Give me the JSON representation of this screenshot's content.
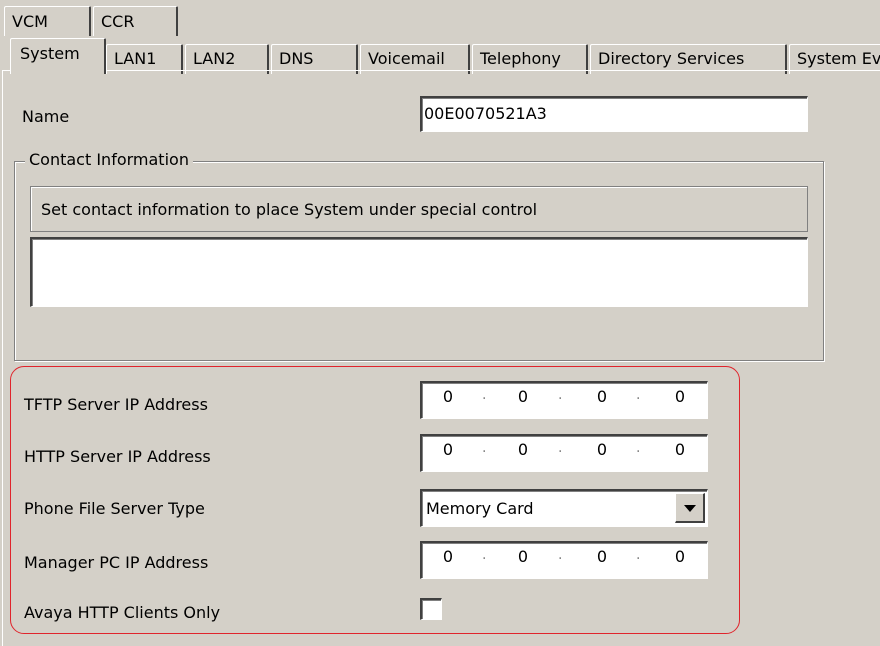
{
  "top_tabs": [
    "VCM",
    "CCR"
  ],
  "tabs": [
    "System",
    "LAN1",
    "LAN2",
    "DNS",
    "Voicemail",
    "Telephony",
    "Directory Services",
    "System Events"
  ],
  "name": {
    "label": "Name",
    "value": "00E0070521A3"
  },
  "contact": {
    "legend": "Contact Information",
    "info_text": "Set contact information to place System under special control",
    "value": ""
  },
  "tftp": {
    "label": "TFTP Server IP Address",
    "ip": [
      "0",
      "0",
      "0",
      "0"
    ]
  },
  "http": {
    "label": "HTTP Server IP Address",
    "ip": [
      "0",
      "0",
      "0",
      "0"
    ]
  },
  "phone_file": {
    "label": "Phone File Server Type",
    "value": "Memory Card"
  },
  "manager": {
    "label": "Manager PC IP Address",
    "ip": [
      "0",
      "0",
      "0",
      "0"
    ]
  },
  "avaya": {
    "label": "Avaya HTTP Clients Only",
    "checked": false
  },
  "colors": {
    "background": "#d4d0c8",
    "highlight": "#e0242c"
  }
}
